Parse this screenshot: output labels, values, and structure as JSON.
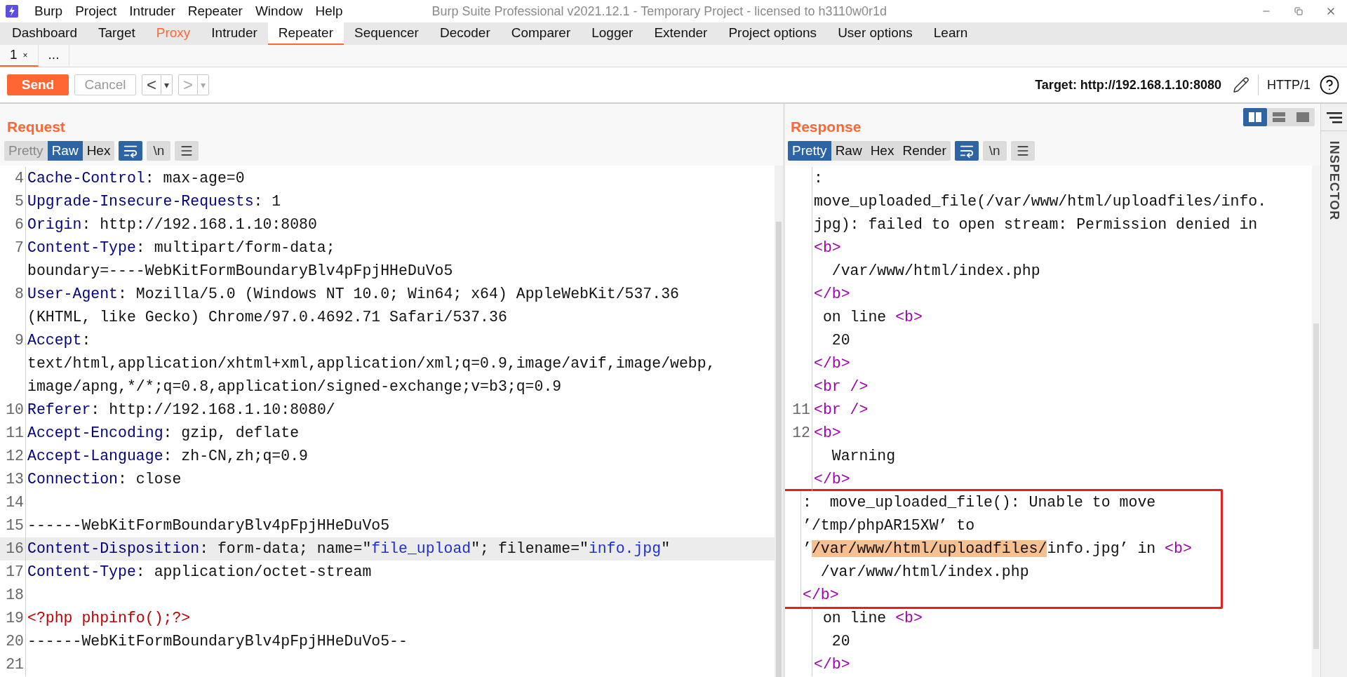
{
  "window": {
    "title": "Burp Suite Professional v2021.12.1 - Temporary Project - licensed to h3110w0r1d"
  },
  "menu": [
    "Burp",
    "Project",
    "Intruder",
    "Repeater",
    "Window",
    "Help"
  ],
  "main_tabs": [
    {
      "label": "Dashboard",
      "selected": false,
      "highlighted": false
    },
    {
      "label": "Target",
      "selected": false,
      "highlighted": false
    },
    {
      "label": "Proxy",
      "selected": false,
      "highlighted": true
    },
    {
      "label": "Intruder",
      "selected": false,
      "highlighted": false
    },
    {
      "label": "Repeater",
      "selected": true,
      "highlighted": false
    },
    {
      "label": "Sequencer",
      "selected": false,
      "highlighted": false
    },
    {
      "label": "Decoder",
      "selected": false,
      "highlighted": false
    },
    {
      "label": "Comparer",
      "selected": false,
      "highlighted": false
    },
    {
      "label": "Logger",
      "selected": false,
      "highlighted": false
    },
    {
      "label": "Extender",
      "selected": false,
      "highlighted": false
    },
    {
      "label": "Project options",
      "selected": false,
      "highlighted": false
    },
    {
      "label": "User options",
      "selected": false,
      "highlighted": false
    },
    {
      "label": "Learn",
      "selected": false,
      "highlighted": false
    }
  ],
  "repeater_tabs": [
    {
      "label": "1",
      "close": "×",
      "selected": true
    },
    {
      "label": "...",
      "selected": false
    }
  ],
  "toolbar": {
    "send": "Send",
    "cancel": {
      "label": "Cancel",
      "disabled": true
    },
    "history": [
      {
        "symbol": "<",
        "caret": "▾",
        "disabled": false
      },
      {
        "symbol": ">",
        "caret": "▾",
        "disabled": true
      }
    ],
    "target": "Target: http://192.168.1.10:8080",
    "protocol": "HTTP/1"
  },
  "layout_toggles": [
    {
      "selected": true
    },
    {
      "selected": false
    },
    {
      "selected": false
    }
  ],
  "request": {
    "title": "Request",
    "view_tabs": [
      {
        "label": "Pretty",
        "selected": false,
        "disabled": true
      },
      {
        "label": "Raw",
        "selected": true,
        "disabled": false
      },
      {
        "label": "Hex",
        "selected": false,
        "disabled": false
      }
    ],
    "wrap_on": true,
    "newline_label": "\\n",
    "lines": [
      {
        "number": "4",
        "segments": [
          {
            "kind": "key",
            "text": "Cache-Control"
          },
          {
            "kind": "plain",
            "text": ": max-age=0"
          }
        ]
      },
      {
        "number": "5",
        "segments": [
          {
            "kind": "key",
            "text": "Upgrade-Insecure-Requests"
          },
          {
            "kind": "plain",
            "text": ": 1"
          }
        ]
      },
      {
        "number": "6",
        "segments": [
          {
            "kind": "key",
            "text": "Origin"
          },
          {
            "kind": "plain",
            "text": ": http://192.168.1.10:8080"
          }
        ]
      },
      {
        "number": "7",
        "segments": [
          {
            "kind": "key",
            "text": "Content-Type"
          },
          {
            "kind": "plain",
            "text": ": multipart/form-data;"
          }
        ]
      },
      {
        "segments": [
          {
            "kind": "plain",
            "text": "boundary=----WebKitFormBoundaryBlv4pFpjHHeDuVo5"
          }
        ]
      },
      {
        "number": "8",
        "segments": [
          {
            "kind": "key",
            "text": "User-Agent"
          },
          {
            "kind": "plain",
            "text": ": Mozilla/5.0 (Windows NT 10.0; Win64; x64) AppleWebKit/537.36"
          }
        ]
      },
      {
        "segments": [
          {
            "kind": "plain",
            "text": "(KHTML, like Gecko) Chrome/97.0.4692.71 Safari/537.36"
          }
        ]
      },
      {
        "number": "9",
        "segments": [
          {
            "kind": "key",
            "text": "Accept"
          },
          {
            "kind": "plain",
            "text": ":"
          }
        ]
      },
      {
        "segments": [
          {
            "kind": "plain",
            "text": "text/html,application/xhtml+xml,application/xml;q=0.9,image/avif,image/webp,"
          }
        ]
      },
      {
        "segments": [
          {
            "kind": "plain",
            "text": "image/apng,*/*;q=0.8,application/signed-exchange;v=b3;q=0.9"
          }
        ]
      },
      {
        "number": "10",
        "segments": [
          {
            "kind": "key",
            "text": "Referer"
          },
          {
            "kind": "plain",
            "text": ": http://192.168.1.10:8080/"
          }
        ]
      },
      {
        "number": "11",
        "segments": [
          {
            "kind": "key",
            "text": "Accept-Encoding"
          },
          {
            "kind": "plain",
            "text": ": gzip, deflate"
          }
        ]
      },
      {
        "number": "12",
        "segments": [
          {
            "kind": "key",
            "text": "Accept-Language"
          },
          {
            "kind": "plain",
            "text": ": zh-CN,zh;q=0.9"
          }
        ]
      },
      {
        "number": "13",
        "segments": [
          {
            "kind": "key",
            "text": "Connection"
          },
          {
            "kind": "plain",
            "text": ": close"
          }
        ]
      },
      {
        "number": "14"
      },
      {
        "number": "15",
        "segments": [
          {
            "kind": "plain",
            "text": "------WebKitFormBoundaryBlv4pFpjHHeDuVo5"
          }
        ]
      },
      {
        "number": "16",
        "current": true,
        "segments": [
          {
            "kind": "key",
            "text": "Content-Disposition"
          },
          {
            "kind": "plain",
            "text": ": form-data; name=\""
          },
          {
            "kind": "value",
            "text": "file_upload"
          },
          {
            "kind": "plain",
            "text": "\"; filename=\""
          },
          {
            "kind": "value",
            "text": "info.jpg"
          },
          {
            "kind": "plain",
            "text": "\""
          }
        ]
      },
      {
        "number": "17",
        "segments": [
          {
            "kind": "key",
            "text": "Content-Type"
          },
          {
            "kind": "plain",
            "text": ": application/octet-stream"
          }
        ]
      },
      {
        "number": "18"
      },
      {
        "number": "19",
        "segments": [
          {
            "kind": "code",
            "text": "<?php phpinfo();?>"
          }
        ]
      },
      {
        "number": "20",
        "segments": [
          {
            "kind": "plain",
            "text": "------WebKitFormBoundaryBlv4pFpjHHeDuVo5--"
          }
        ]
      },
      {
        "number": "21"
      }
    ]
  },
  "response": {
    "title": "Response",
    "view_tabs": [
      {
        "label": "Pretty",
        "selected": true,
        "disabled": false
      },
      {
        "label": "Raw",
        "selected": false,
        "disabled": false
      },
      {
        "label": "Hex",
        "selected": false,
        "disabled": false
      },
      {
        "label": "Render",
        "selected": false,
        "disabled": false
      }
    ],
    "wrap_on": true,
    "newline_label": "\\n",
    "blocks": [
      {
        "boxed": false,
        "lines": [
          {
            "segments": [
              {
                "kind": "plain",
                "text": ":"
              }
            ]
          },
          {
            "segments": [
              {
                "kind": "plain",
                "text": "move_uploaded_file(/var/www/html/uploadfiles/info."
              }
            ]
          },
          {
            "segments": [
              {
                "kind": "plain",
                "text": "jpg): failed to open stream: Permission denied in"
              }
            ]
          },
          {
            "segments": [
              {
                "kind": "tag",
                "text": "<b>"
              }
            ]
          },
          {
            "segments": [
              {
                "kind": "plain",
                "text": "  /var/www/html/index.php"
              }
            ]
          },
          {
            "segments": [
              {
                "kind": "tag",
                "text": "</b>"
              }
            ]
          },
          {
            "segments": [
              {
                "kind": "plain",
                "text": " on line "
              },
              {
                "kind": "tag",
                "text": "<b>"
              }
            ]
          },
          {
            "segments": [
              {
                "kind": "plain",
                "text": "  20"
              }
            ]
          },
          {
            "segments": [
              {
                "kind": "tag",
                "text": "</b>"
              }
            ]
          },
          {
            "segments": [
              {
                "kind": "tag",
                "text": "<br />"
              }
            ]
          },
          {
            "number": "11",
            "segments": [
              {
                "kind": "tag",
                "text": "<br />"
              }
            ]
          },
          {
            "number": "12",
            "segments": [
              {
                "kind": "tag",
                "text": "<b>"
              }
            ]
          },
          {
            "segments": [
              {
                "kind": "plain",
                "text": "  Warning"
              }
            ]
          },
          {
            "segments": [
              {
                "kind": "tag",
                "text": "</b>"
              }
            ]
          }
        ]
      },
      {
        "boxed": true,
        "lines": [
          {
            "segments": [
              {
                "kind": "plain",
                "text": ":  move_uploaded_file(): Unable to move"
              }
            ]
          },
          {
            "segments": [
              {
                "kind": "plain",
                "text": "’/tmp/phpAR15XW’ to"
              }
            ]
          },
          {
            "segments": [
              {
                "kind": "plain",
                "text": "’"
              },
              {
                "kind": "highlight",
                "text": "/var/www/html/uploadfiles/"
              },
              {
                "kind": "plain",
                "text": "info.jpg’ in "
              },
              {
                "kind": "tag",
                "text": "<b>"
              }
            ]
          },
          {
            "segments": [
              {
                "kind": "plain",
                "text": "  /var/www/html/index.php"
              }
            ]
          },
          {
            "segments": [
              {
                "kind": "tag",
                "text": "</b>"
              }
            ]
          }
        ]
      },
      {
        "boxed": false,
        "lines": [
          {
            "segments": [
              {
                "kind": "plain",
                "text": " on line "
              },
              {
                "kind": "tag",
                "text": "<b>"
              }
            ]
          },
          {
            "segments": [
              {
                "kind": "plain",
                "text": "  20"
              }
            ]
          },
          {
            "segments": [
              {
                "kind": "tag",
                "text": "</b>"
              }
            ]
          }
        ]
      }
    ]
  },
  "inspector": {
    "label": "INSPECTOR"
  }
}
